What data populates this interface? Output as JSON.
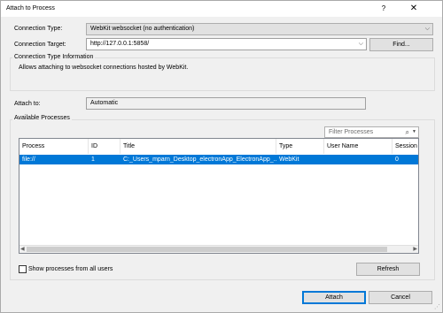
{
  "window": {
    "title": "Attach to Process",
    "help_label": "?",
    "close_label": "✕"
  },
  "connection": {
    "type_label": "Connection Type:",
    "type_value": "WebKit websocket (no authentication)",
    "target_label": "Connection Target:",
    "target_value": "http://127.0.0.1:5858/",
    "find_label": "Find..."
  },
  "info": {
    "group_title": "Connection Type Information",
    "text": "Allows attaching to websocket connections hosted by WebKit."
  },
  "attach_to": {
    "label": "Attach to:",
    "value": "Automatic"
  },
  "processes": {
    "group_title": "Available Processes",
    "filter_placeholder": "Filter Processes",
    "columns": [
      "Process",
      "ID",
      "Title",
      "Type",
      "User Name",
      "Session"
    ],
    "rows": [
      {
        "process": "file://",
        "id": "1",
        "title": "C:_Users_mparn_Desktop_electronApp_ElectronApp_...",
        "type": "WebKit",
        "user_name": "",
        "session": "0"
      }
    ],
    "show_all_label": "Show processes from all users",
    "refresh_label": "Refresh"
  },
  "footer": {
    "attach_label": "Attach",
    "cancel_label": "Cancel"
  },
  "colors": {
    "selection": "#0078d7",
    "dialog_bg": "#f0f0f0"
  }
}
